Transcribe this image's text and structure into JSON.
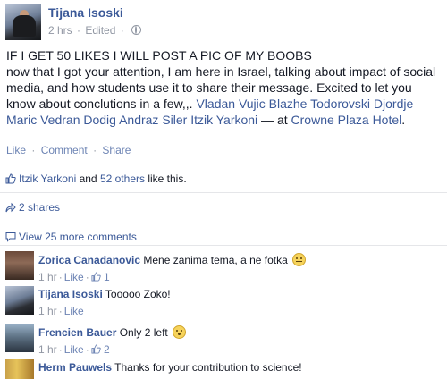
{
  "post": {
    "author": "Tijana Isoski",
    "time": "2 hrs",
    "dot": "·",
    "edited": "Edited",
    "dot2": "·",
    "line1": "IF I GET 50 LIKES I WILL POST A PIC OF MY BOOBS",
    "body_prefix": "now that I got your attention, I am here in Israel, talking about impact of social media, and how students use it to share their message. Excited to let you know about conclutions in a few,,. ",
    "tags": "Vladan Vujic Blazhe Todorovski Djordje Maric Vedran Dodig Andraz Siler Itzik Yarkoni",
    "at_text": " — at ",
    "place": "Crowne Plaza Hotel",
    "place_end": "."
  },
  "actions": {
    "like": "Like",
    "sep1": "·",
    "comment": "Comment",
    "sep2": "·",
    "share": "Share"
  },
  "likes": {
    "person": "Itzik Yarkoni",
    "and": " and ",
    "others": "52 others",
    "suffix": " like this."
  },
  "shares": {
    "label": "2 shares"
  },
  "view_more": {
    "label": "View 25 more comments"
  },
  "comments": [
    {
      "name": "Zorica Canadanovic",
      "text": " Mene zanima tema, a ne fotka ",
      "emoji": "smile-emoji",
      "time": "1 hr",
      "like_label": "Like",
      "like_count": "1"
    },
    {
      "name": "Tijana Isoski",
      "text": " Tooooo Zoko!",
      "time": "1 hr",
      "like_label": "Like"
    },
    {
      "name": "Frencien Bauer",
      "text": " Only 2 left ",
      "emoji": "surprised-emoji",
      "time": "1 hr",
      "like_label": "Like",
      "like_count": "2"
    },
    {
      "name": "Herm Pauwels",
      "text": " Thanks for your contribution to science!"
    }
  ],
  "colors": {
    "link": "#3b5998",
    "action": "#6d84b4",
    "meta": "#9197a3",
    "divider": "#e5e6e9"
  }
}
